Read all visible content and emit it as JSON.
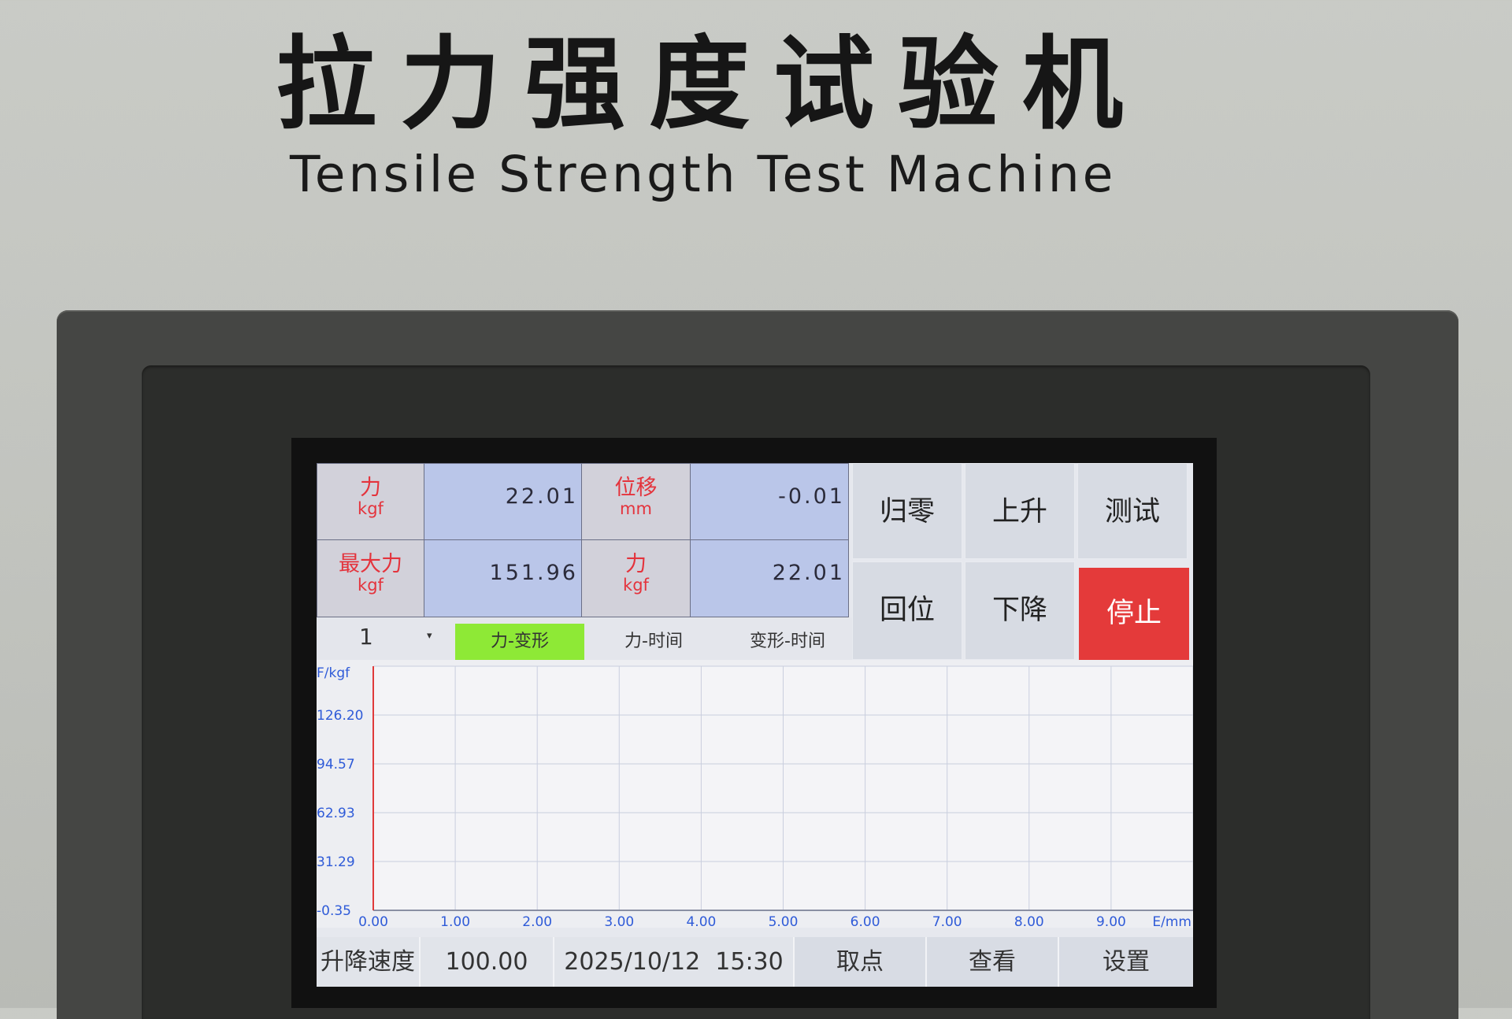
{
  "panel": {
    "title_cn": "拉力强度试验机",
    "title_en": "Tensile Strength Test Machine"
  },
  "readings": {
    "force_label": "力",
    "force_unit": "kgf",
    "force_value": "22.01",
    "displacement_label": "位移",
    "displacement_unit": "mm",
    "displacement_value": "-0.01",
    "max_force_label": "最大力",
    "max_force_unit": "kgf",
    "max_force_value": "151.96",
    "force2_label": "力",
    "force2_unit": "kgf",
    "force2_value": "22.01"
  },
  "buttons": {
    "zero": "归零",
    "up": "上升",
    "test": "测试",
    "return": "回位",
    "down": "下降",
    "stop": "停止"
  },
  "tabs": {
    "selector_value": "1",
    "selector_arrow": "▾",
    "items": [
      "力-变形",
      "力-时间",
      "变形-时间"
    ],
    "active_index": 0
  },
  "chart_data": {
    "type": "line",
    "ylabel": "F/kgf",
    "xlabel": "E/mm",
    "y_ticks": [
      "-0.35",
      "31.29",
      "62.93",
      "94.57",
      "126.20"
    ],
    "x_ticks": [
      "0.00",
      "1.00",
      "2.00",
      "3.00",
      "4.00",
      "5.00",
      "6.00",
      "7.00",
      "8.00",
      "9.00"
    ],
    "xlim": [
      0,
      10
    ],
    "ylim": [
      -0.35,
      157.84
    ],
    "grid": true,
    "series": []
  },
  "bottom_bar": {
    "speed_label": "升降速度",
    "speed_value": "100.00",
    "datetime": "2025/10/12  15:30",
    "sample_button": "取点",
    "view_button": "查看",
    "settings_button": "设置"
  },
  "colors": {
    "active_tab": "#8ee936",
    "stop_button": "#e43a3a",
    "label_text": "#e4333c",
    "value_cell": "#bac6e9",
    "axis_red": "#e03a3a",
    "tick_blue": "#2f5bd8"
  }
}
